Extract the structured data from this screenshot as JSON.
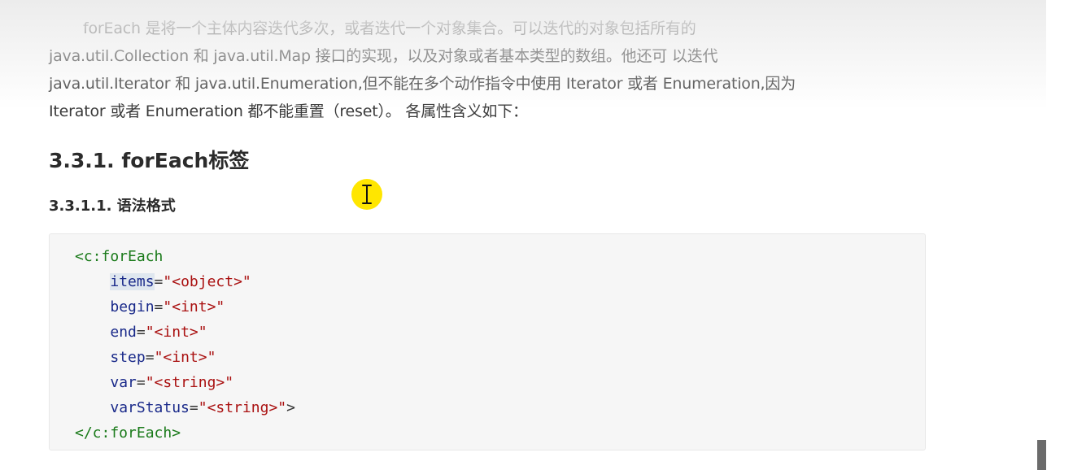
{
  "intro": {
    "line1": "forEach 是将一个主体内容迭代多次，或者迭代一个对象集合。可以迭代的对象包括所有的",
    "line2": "java.util.Collection 和 java.util.Map 接口的实现，以及对象或者基本类型的数组。他还可 以迭代",
    "line3": "java.util.Iterator 和 java.util.Enumeration,但不能在多个动作指令中使用 Iterator 或者 Enumeration,因为",
    "line4": "Iterator 或者 Enumeration 都不能重置（reset）。 各属性含义如下："
  },
  "section_heading": "3.3.1. forEach标签",
  "subsection_heading": "3.3.1.1. 语法格式",
  "code": {
    "open_tag": "<c:forEach",
    "attributes": [
      {
        "name": "items",
        "value": "\"<object>\""
      },
      {
        "name": "begin",
        "value": "\"<int>\""
      },
      {
        "name": "end",
        "value": "\"<int>\""
      },
      {
        "name": "step",
        "value": "\"<int>\""
      },
      {
        "name": "var",
        "value": "\"<string>\""
      },
      {
        "name": "varStatus",
        "value": "\"<string>\""
      }
    ],
    "close_bracket": ">",
    "close_tag": "</c:forEach>"
  },
  "cursor_icon": "text-cursor-icon",
  "colors": {
    "cursor_highlight": "#ffe600",
    "code_tag": "#1a7a1a",
    "code_attr": "#1a2a8a",
    "code_value": "#a11111"
  }
}
